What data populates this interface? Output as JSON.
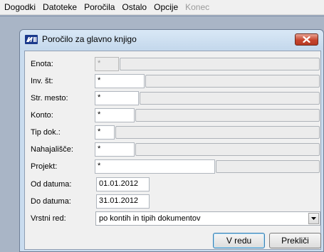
{
  "menu": {
    "items": [
      "Dogodki",
      "Datoteke",
      "Poročila",
      "Ostalo",
      "Opcije"
    ],
    "disabled_item": "Konec"
  },
  "dialog": {
    "title": "Poročilo za glavno knjigo",
    "icon": "app-logo-icon",
    "fields": {
      "enota": {
        "label": "Enota:",
        "value": "*"
      },
      "inv_st": {
        "label": "Inv. št:",
        "value": "*"
      },
      "str_mesto": {
        "label": "Str. mesto:",
        "value": "*"
      },
      "konto": {
        "label": "Konto:",
        "value": "*"
      },
      "tip_dok": {
        "label": "Tip dok.:",
        "value": "*"
      },
      "nahajalisce": {
        "label": "Nahajališče:",
        "value": "*"
      },
      "projekt": {
        "label": "Projekt:",
        "value": "*"
      },
      "od_datuma": {
        "label": "Od datuma:",
        "value": "01.01.2012"
      },
      "do_datuma": {
        "label": "Do datuma:",
        "value": "31.01.2012"
      },
      "vrstni_red": {
        "label": "Vrstni red:",
        "value": "po kontih in tipih dokumentov"
      }
    },
    "buttons": {
      "ok": "V redu",
      "cancel": "Prekliči"
    }
  },
  "colors": {
    "desktop": "#a9b5c6",
    "dialog_frame": "#c9dcef",
    "close_button": "#c7452f"
  }
}
